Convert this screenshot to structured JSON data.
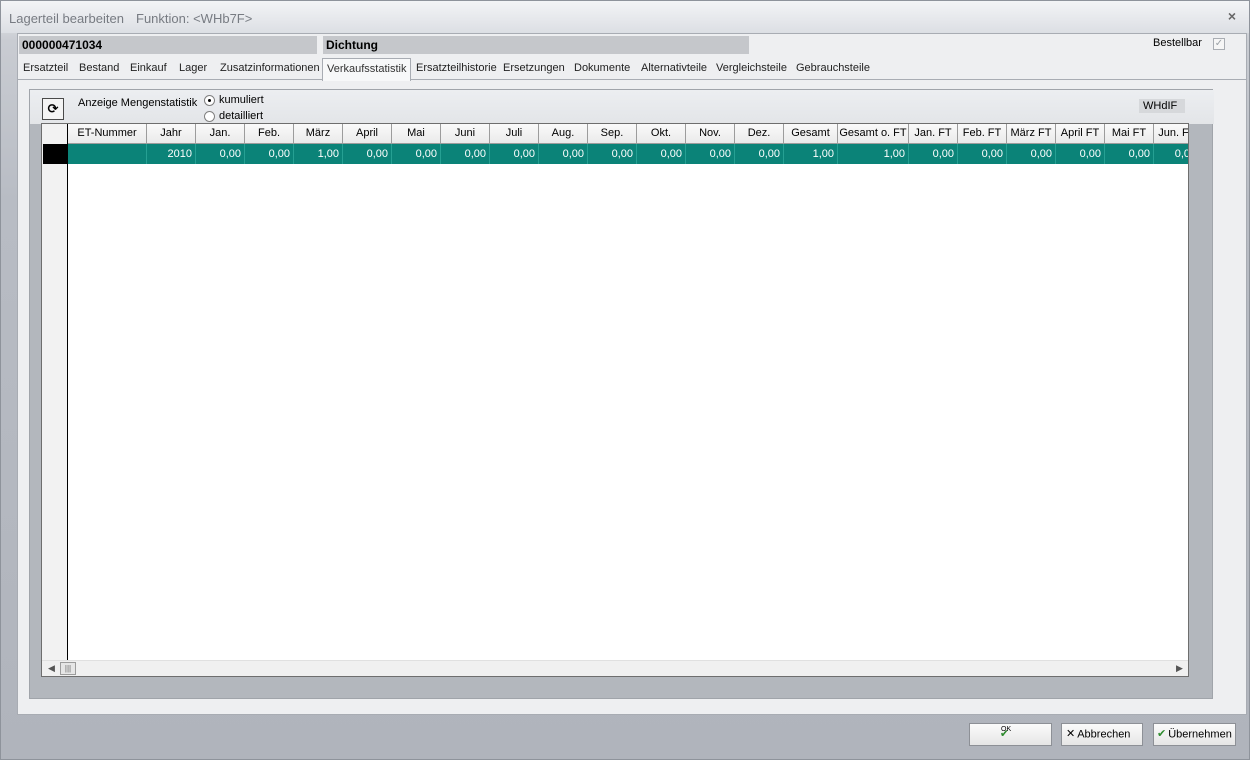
{
  "window": {
    "title": "Lagerteil bearbeiten",
    "function_label": "Funktion: <WHb7F>",
    "close_glyph": "×"
  },
  "record": {
    "id": "000000471034",
    "name": "Dichtung",
    "bestellbar_label": "Bestellbar",
    "bestellbar_checked": true
  },
  "tabs": [
    {
      "label": "Ersatzteil"
    },
    {
      "label": "Bestand"
    },
    {
      "label": "Einkauf"
    },
    {
      "label": "Lager"
    },
    {
      "label": "Zusatzinformationen"
    },
    {
      "label": "Verkaufsstatistik",
      "active": true
    },
    {
      "label": "Ersatzteilhistorie"
    },
    {
      "label": "Ersetzungen"
    },
    {
      "label": "Dokumente"
    },
    {
      "label": "Alternativteile"
    },
    {
      "label": "Vergleichsteile"
    },
    {
      "label": "Gebrauchsteile"
    }
  ],
  "stats": {
    "refresh_icon": "refresh-icon",
    "anzeige_label": "Anzeige Mengenstatistik",
    "radio_kumuliert": "kumuliert",
    "radio_detailliert": "detailliert",
    "selected_mode": "kumuliert",
    "code_label": "WHdIF"
  },
  "grid": {
    "columns": [
      "ET-Nummer",
      "Jahr",
      "Jan.",
      "Feb.",
      "März",
      "April",
      "Mai",
      "Juni",
      "Juli",
      "Aug.",
      "Sep.",
      "Okt.",
      "Nov.",
      "Dez.",
      "Gesamt",
      "Gesamt o. FT",
      "Jan. FT",
      "Feb. FT",
      "März FT",
      "April FT",
      "Mai FT",
      "Jun. F"
    ],
    "rows": [
      [
        "",
        "2010",
        "0,00",
        "0,00",
        "1,00",
        "0,00",
        "0,00",
        "0,00",
        "0,00",
        "0,00",
        "0,00",
        "0,00",
        "0,00",
        "0,00",
        "1,00",
        "1,00",
        "0,00",
        "0,00",
        "0,00",
        "0,00",
        "0,00",
        "0,0"
      ]
    ],
    "selected_row_color": "#0b8378"
  },
  "buttons": {
    "ok_label": "OK",
    "cancel_label": "Abbrechen",
    "apply_label": "Übernehmen"
  },
  "colors": {
    "accent_teal": "#0b8378"
  }
}
